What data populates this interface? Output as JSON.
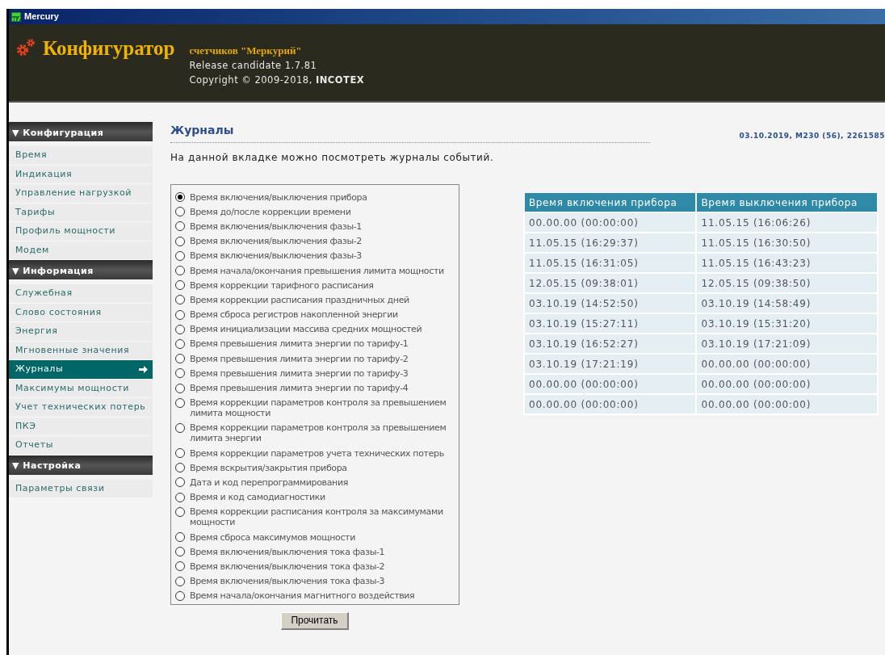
{
  "window": {
    "title": "Mercury"
  },
  "header": {
    "title": "Конфигуратор",
    "subtitle": "счетчиков \"Меркурий\"",
    "release": "Release candidate 1.7.81",
    "copyright": "Copyright © 2009-2018, **INCOTEX**"
  },
  "sidebar": {
    "sections": [
      {
        "title": "▼ Конфигурация",
        "items": [
          {
            "label": "Время",
            "selected": false
          },
          {
            "label": "Индикация",
            "selected": false
          },
          {
            "label": "Управление нагрузкой",
            "selected": false
          },
          {
            "label": "Тарифы",
            "selected": false
          },
          {
            "label": "Профиль мощности",
            "selected": false
          },
          {
            "label": "Модем",
            "selected": false
          }
        ]
      },
      {
        "title": "▼ Информация",
        "items": [
          {
            "label": "Служебная",
            "selected": false
          },
          {
            "label": "Слово состояния",
            "selected": false
          },
          {
            "label": "Энергия",
            "selected": false
          },
          {
            "label": "Мгновенные значения",
            "selected": false
          },
          {
            "label": "Журналы",
            "selected": true
          },
          {
            "label": "Максимумы мощности",
            "selected": false
          },
          {
            "label": "Учет технических потерь",
            "selected": false
          },
          {
            "label": "ПКЭ",
            "selected": false
          },
          {
            "label": "Отчеты",
            "selected": false
          }
        ]
      },
      {
        "title": "▼ Настройка",
        "items": [
          {
            "label": "Параметры связи",
            "selected": false
          }
        ]
      }
    ]
  },
  "page": {
    "title": "Журналы",
    "device_info": "03.10.2019, M230 (56), 2261585",
    "description": "На данной вкладке можно посмотреть журналы событий."
  },
  "journals": [
    {
      "label": "Время включения/выключения прибора",
      "selected": true
    },
    {
      "label": "Время до/после коррекции времени",
      "selected": false
    },
    {
      "label": "Время включения/выключения фазы-1",
      "selected": false
    },
    {
      "label": "Время включения/выключения фазы-2",
      "selected": false
    },
    {
      "label": "Время включения/выключения фазы-3",
      "selected": false
    },
    {
      "label": "Время начала/окончания превышения лимита мощности",
      "selected": false
    },
    {
      "label": "Время коррекции тарифного расписания",
      "selected": false
    },
    {
      "label": "Время коррекции расписания праздничных дней",
      "selected": false
    },
    {
      "label": "Время сброса регистров накопленной энергии",
      "selected": false
    },
    {
      "label": "Время инициализации массива средних мощностей",
      "selected": false
    },
    {
      "label": "Время превышения лимита энергии по тарифу-1",
      "selected": false
    },
    {
      "label": "Время превышения лимита энергии по тарифу-2",
      "selected": false
    },
    {
      "label": "Время превышения лимита энергии по тарифу-3",
      "selected": false
    },
    {
      "label": "Время превышения лимита энергии по тарифу-4",
      "selected": false
    },
    {
      "label": "Время коррекции параметров контроля за превышением лимита мощности",
      "selected": false
    },
    {
      "label": "Время коррекции параметров контроля за превышением лимита энергии",
      "selected": false
    },
    {
      "label": "Время коррекции параметров учета технических потерь",
      "selected": false
    },
    {
      "label": "Время вскрытия/закрытия прибора",
      "selected": false
    },
    {
      "label": "Дата и код перепрограммирования",
      "selected": false
    },
    {
      "label": "Время и код самодиагностики",
      "selected": false
    },
    {
      "label": "Время коррекции расписания контроля за максимумами мощности",
      "selected": false
    },
    {
      "label": "Время сброса максимумов мощности",
      "selected": false
    },
    {
      "label": "Время включения/выключения тока фазы-1",
      "selected": false
    },
    {
      "label": "Время включения/выключения тока фазы-2",
      "selected": false
    },
    {
      "label": "Время включения/выключения тока фазы-3",
      "selected": false
    },
    {
      "label": "Время начала/окончания магнитного воздействия",
      "selected": false
    }
  ],
  "read_button": "Прочитать",
  "table": {
    "columns": [
      "Время включения прибора",
      "Время выключения прибора"
    ],
    "rows": [
      [
        "00.00.00 (00:00:00)",
        "11.05.15 (16:06:26)"
      ],
      [
        "11.05.15 (16:29:37)",
        "11.05.15 (16:30:50)"
      ],
      [
        "11.05.15 (16:31:05)",
        "11.05.15 (16:43:23)"
      ],
      [
        "12.05.15 (09:38:01)",
        "12.05.15 (09:38:50)"
      ],
      [
        "03.10.19 (14:52:50)",
        "03.10.19 (14:58:49)"
      ],
      [
        "03.10.19 (15:27:11)",
        "03.10.19 (15:31:20)"
      ],
      [
        "03.10.19 (16:52:27)",
        "03.10.19 (17:21:09)"
      ],
      [
        "03.10.19 (17:21:19)",
        "00.00.00 (00:00:00)"
      ],
      [
        "00.00.00 (00:00:00)",
        "00.00.00 (00:00:00)"
      ],
      [
        "00.00.00 (00:00:00)",
        "00.00.00 (00:00:00)"
      ]
    ]
  }
}
